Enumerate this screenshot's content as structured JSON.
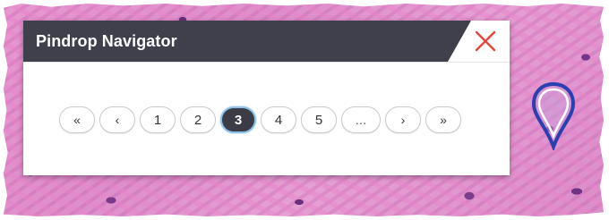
{
  "navigator": {
    "title": "Pindrop Navigator",
    "close_icon": "close-icon",
    "colors": {
      "header": "#40404d",
      "close": "#e0473a",
      "active_page": "#3c3c47",
      "active_border": "#8ec1ea"
    }
  },
  "pagination": {
    "first_label": "«",
    "prev_label": "‹",
    "pages": [
      "1",
      "2",
      "3",
      "4",
      "5"
    ],
    "current_page": "3",
    "ellipsis_label": "...",
    "next_label": "›",
    "last_label": "»"
  },
  "background": {
    "description_icon": "histology-slide",
    "pin_icon": "map-pin-icon",
    "pin_color": "#2a3fb0"
  }
}
